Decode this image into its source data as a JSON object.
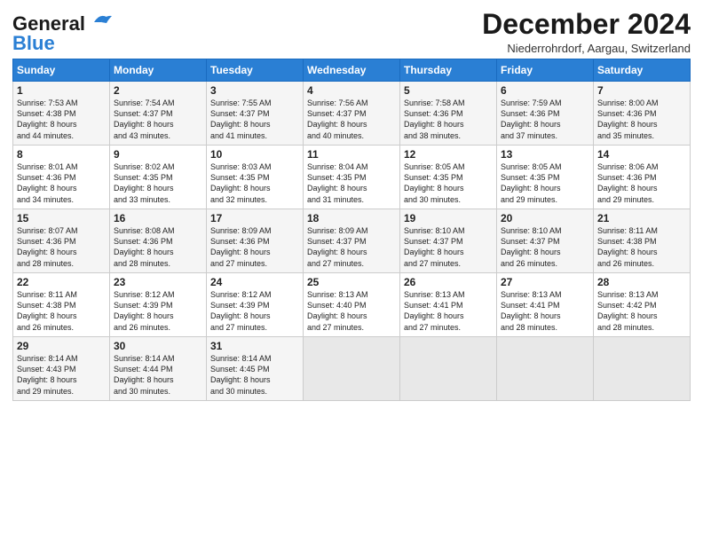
{
  "logo": {
    "line1": "General",
    "line2": "Blue"
  },
  "title": "December 2024",
  "location": "Niederrohrdorf, Aargau, Switzerland",
  "days_of_week": [
    "Sunday",
    "Monday",
    "Tuesday",
    "Wednesday",
    "Thursday",
    "Friday",
    "Saturday"
  ],
  "weeks": [
    [
      {
        "day": "1",
        "info": "Sunrise: 7:53 AM\nSunset: 4:38 PM\nDaylight: 8 hours\nand 44 minutes."
      },
      {
        "day": "2",
        "info": "Sunrise: 7:54 AM\nSunset: 4:37 PM\nDaylight: 8 hours\nand 43 minutes."
      },
      {
        "day": "3",
        "info": "Sunrise: 7:55 AM\nSunset: 4:37 PM\nDaylight: 8 hours\nand 41 minutes."
      },
      {
        "day": "4",
        "info": "Sunrise: 7:56 AM\nSunset: 4:37 PM\nDaylight: 8 hours\nand 40 minutes."
      },
      {
        "day": "5",
        "info": "Sunrise: 7:58 AM\nSunset: 4:36 PM\nDaylight: 8 hours\nand 38 minutes."
      },
      {
        "day": "6",
        "info": "Sunrise: 7:59 AM\nSunset: 4:36 PM\nDaylight: 8 hours\nand 37 minutes."
      },
      {
        "day": "7",
        "info": "Sunrise: 8:00 AM\nSunset: 4:36 PM\nDaylight: 8 hours\nand 35 minutes."
      }
    ],
    [
      {
        "day": "8",
        "info": "Sunrise: 8:01 AM\nSunset: 4:36 PM\nDaylight: 8 hours\nand 34 minutes."
      },
      {
        "day": "9",
        "info": "Sunrise: 8:02 AM\nSunset: 4:35 PM\nDaylight: 8 hours\nand 33 minutes."
      },
      {
        "day": "10",
        "info": "Sunrise: 8:03 AM\nSunset: 4:35 PM\nDaylight: 8 hours\nand 32 minutes."
      },
      {
        "day": "11",
        "info": "Sunrise: 8:04 AM\nSunset: 4:35 PM\nDaylight: 8 hours\nand 31 minutes."
      },
      {
        "day": "12",
        "info": "Sunrise: 8:05 AM\nSunset: 4:35 PM\nDaylight: 8 hours\nand 30 minutes."
      },
      {
        "day": "13",
        "info": "Sunrise: 8:05 AM\nSunset: 4:35 PM\nDaylight: 8 hours\nand 29 minutes."
      },
      {
        "day": "14",
        "info": "Sunrise: 8:06 AM\nSunset: 4:36 PM\nDaylight: 8 hours\nand 29 minutes."
      }
    ],
    [
      {
        "day": "15",
        "info": "Sunrise: 8:07 AM\nSunset: 4:36 PM\nDaylight: 8 hours\nand 28 minutes."
      },
      {
        "day": "16",
        "info": "Sunrise: 8:08 AM\nSunset: 4:36 PM\nDaylight: 8 hours\nand 28 minutes."
      },
      {
        "day": "17",
        "info": "Sunrise: 8:09 AM\nSunset: 4:36 PM\nDaylight: 8 hours\nand 27 minutes."
      },
      {
        "day": "18",
        "info": "Sunrise: 8:09 AM\nSunset: 4:37 PM\nDaylight: 8 hours\nand 27 minutes."
      },
      {
        "day": "19",
        "info": "Sunrise: 8:10 AM\nSunset: 4:37 PM\nDaylight: 8 hours\nand 27 minutes."
      },
      {
        "day": "20",
        "info": "Sunrise: 8:10 AM\nSunset: 4:37 PM\nDaylight: 8 hours\nand 26 minutes."
      },
      {
        "day": "21",
        "info": "Sunrise: 8:11 AM\nSunset: 4:38 PM\nDaylight: 8 hours\nand 26 minutes."
      }
    ],
    [
      {
        "day": "22",
        "info": "Sunrise: 8:11 AM\nSunset: 4:38 PM\nDaylight: 8 hours\nand 26 minutes."
      },
      {
        "day": "23",
        "info": "Sunrise: 8:12 AM\nSunset: 4:39 PM\nDaylight: 8 hours\nand 26 minutes."
      },
      {
        "day": "24",
        "info": "Sunrise: 8:12 AM\nSunset: 4:39 PM\nDaylight: 8 hours\nand 27 minutes."
      },
      {
        "day": "25",
        "info": "Sunrise: 8:13 AM\nSunset: 4:40 PM\nDaylight: 8 hours\nand 27 minutes."
      },
      {
        "day": "26",
        "info": "Sunrise: 8:13 AM\nSunset: 4:41 PM\nDaylight: 8 hours\nand 27 minutes."
      },
      {
        "day": "27",
        "info": "Sunrise: 8:13 AM\nSunset: 4:41 PM\nDaylight: 8 hours\nand 28 minutes."
      },
      {
        "day": "28",
        "info": "Sunrise: 8:13 AM\nSunset: 4:42 PM\nDaylight: 8 hours\nand 28 minutes."
      }
    ],
    [
      {
        "day": "29",
        "info": "Sunrise: 8:14 AM\nSunset: 4:43 PM\nDaylight: 8 hours\nand 29 minutes."
      },
      {
        "day": "30",
        "info": "Sunrise: 8:14 AM\nSunset: 4:44 PM\nDaylight: 8 hours\nand 30 minutes."
      },
      {
        "day": "31",
        "info": "Sunrise: 8:14 AM\nSunset: 4:45 PM\nDaylight: 8 hours\nand 30 minutes."
      },
      null,
      null,
      null,
      null
    ]
  ]
}
